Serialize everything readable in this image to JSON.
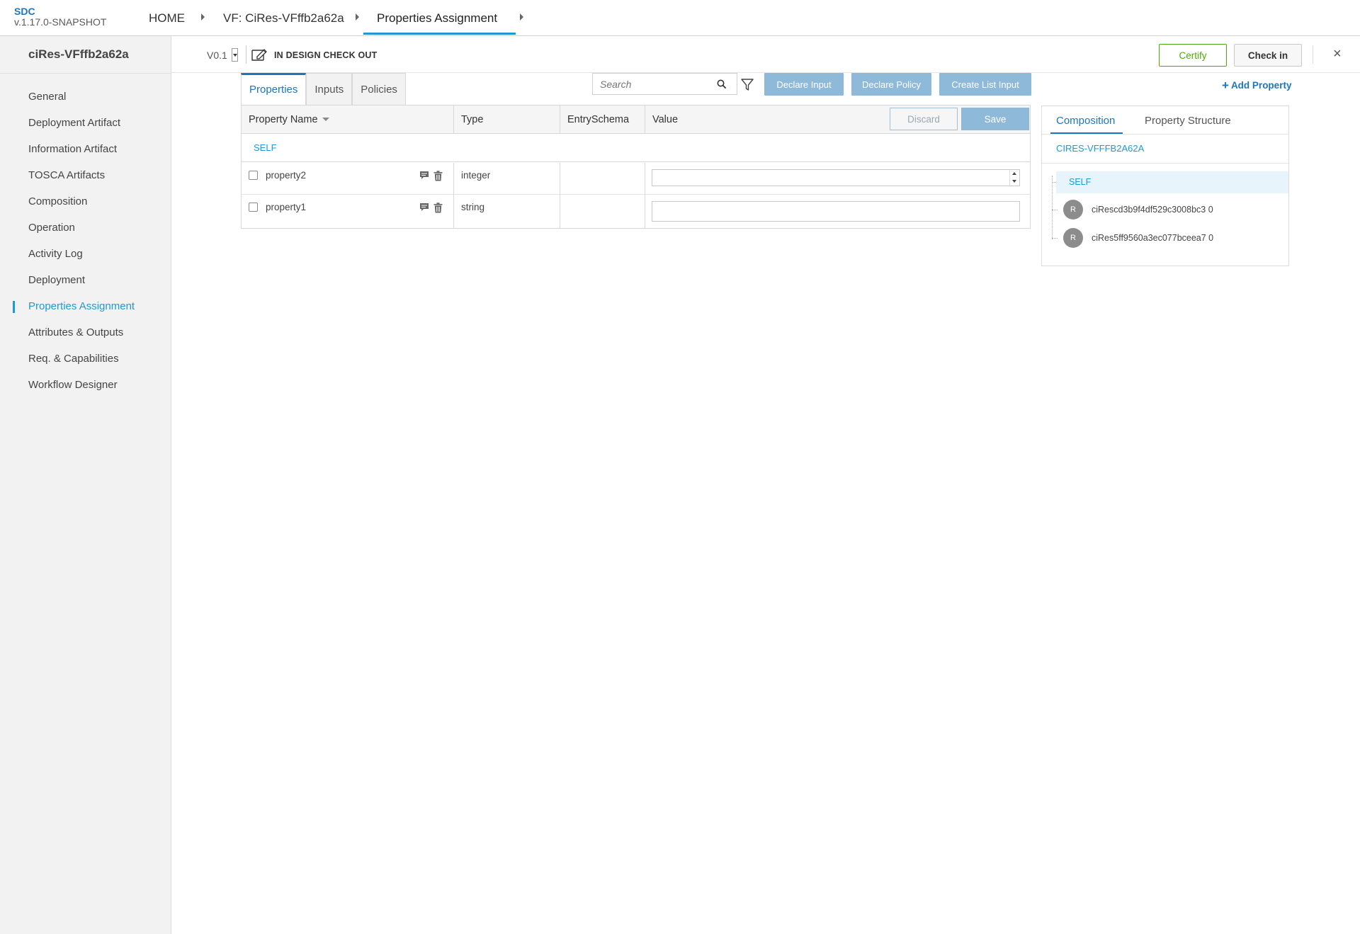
{
  "brand": {
    "name": "SDC",
    "version": "v.1.17.0-SNAPSHOT"
  },
  "breadcrumbs": [
    "HOME",
    "VF: CiRes-VFffb2a62a",
    "Properties Assignment"
  ],
  "sidebar": {
    "title": "ciRes-VFffb2a62a",
    "items": [
      "General",
      "Deployment Artifact",
      "Information Artifact",
      "TOSCA Artifacts",
      "Composition",
      "Operation",
      "Activity Log",
      "Deployment",
      "Properties Assignment",
      "Attributes & Outputs",
      "Req. & Capabilities",
      "Workflow Designer"
    ],
    "active": "Properties Assignment"
  },
  "subheader": {
    "version": "V0.1",
    "status": "IN DESIGN CHECK OUT",
    "certify": "Certify",
    "checkin": "Check in",
    "close": "×"
  },
  "tabs": [
    "Properties",
    "Inputs",
    "Policies"
  ],
  "search": {
    "placeholder": "Search"
  },
  "actions": {
    "declare_input": "Declare Input",
    "declare_policy": "Declare Policy",
    "create_list_input": "Create List Input",
    "add_property": "Add Property"
  },
  "table": {
    "columns": [
      "Property Name",
      "Type",
      "EntrySchema",
      "Value"
    ],
    "discard": "Discard",
    "save": "Save",
    "group": "SELF",
    "rows": [
      {
        "name": "property2",
        "type": "integer",
        "entry_schema": "",
        "value": ""
      },
      {
        "name": "property1",
        "type": "string",
        "entry_schema": "",
        "value": ""
      }
    ]
  },
  "right_panel": {
    "tabs": [
      "Composition",
      "Property Structure"
    ],
    "component": "CIRES-VFFFB2A62A",
    "self": "SELF",
    "instances": [
      {
        "avatar": "R",
        "label": "ciRescd3b9f4df529c3008bc3 0"
      },
      {
        "avatar": "R",
        "label": "ciRes5ff9560a3ec077bceea7 0"
      }
    ]
  },
  "colors": {
    "accent": "#1d9ad6",
    "primary": "#1d76b8",
    "certify": "#4ca90c",
    "disabled_button": "#8fb9d9"
  }
}
